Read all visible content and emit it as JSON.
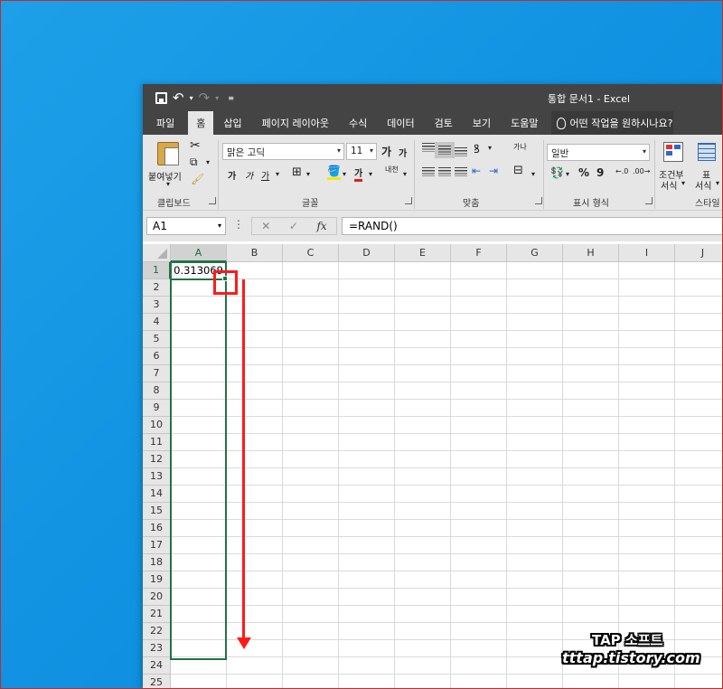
{
  "titlebar": {
    "doc_title": "통합 문서1  -  Excel",
    "qat_icons": [
      "save-icon",
      "undo-icon",
      "redo-icon",
      "customize-icon"
    ]
  },
  "tabs": [
    "파일",
    "홈",
    "삽입",
    "페이지 레이아웃",
    "수식",
    "데이터",
    "검토",
    "보기",
    "도움말"
  ],
  "active_tab": "홈",
  "tellme": "어떤 작업을 원하시나요?",
  "ribbon": {
    "clipboard": {
      "paste": "붙여넣기",
      "label": "클립보드"
    },
    "font": {
      "name": "맑은 고딕",
      "size": "11",
      "grow": "가",
      "shrink": "가",
      "bold": "가",
      "italic": "가",
      "underline": "가",
      "color_a": "가",
      "phonetic": "내천",
      "label": "글꼴"
    },
    "alignment": {
      "wrap": "가나",
      "label": "맞춤"
    },
    "number": {
      "format": "일반",
      "percent": "%",
      "comma": "9",
      "label": "표시 형식"
    },
    "styles": {
      "cond": "조건부",
      "cond2": "서식",
      "table": "표",
      "table2": "서식",
      "label": "스타일"
    }
  },
  "formula_bar": {
    "name_box": "A1",
    "formula": "=RAND()"
  },
  "sheet": {
    "columns": [
      "A",
      "B",
      "C",
      "D",
      "E",
      "F",
      "G",
      "H",
      "I",
      "J"
    ],
    "rows": [
      "1",
      "2",
      "3",
      "4",
      "5",
      "6",
      "7",
      "8",
      "9",
      "10",
      "11",
      "12",
      "13",
      "14",
      "15",
      "16",
      "17",
      "18",
      "19",
      "20",
      "21",
      "22",
      "23",
      "24",
      "25"
    ],
    "active_cell": "A1",
    "a1_value": "0.313069"
  },
  "watermark": {
    "line1": "TAP 소프트",
    "line2": "tttap.tistory.com"
  },
  "colors": {
    "excel_green": "#217346",
    "annotation_red": "#ff1a1a",
    "desktop_blue": "#0e8fe0",
    "titlebar": "#444444"
  }
}
